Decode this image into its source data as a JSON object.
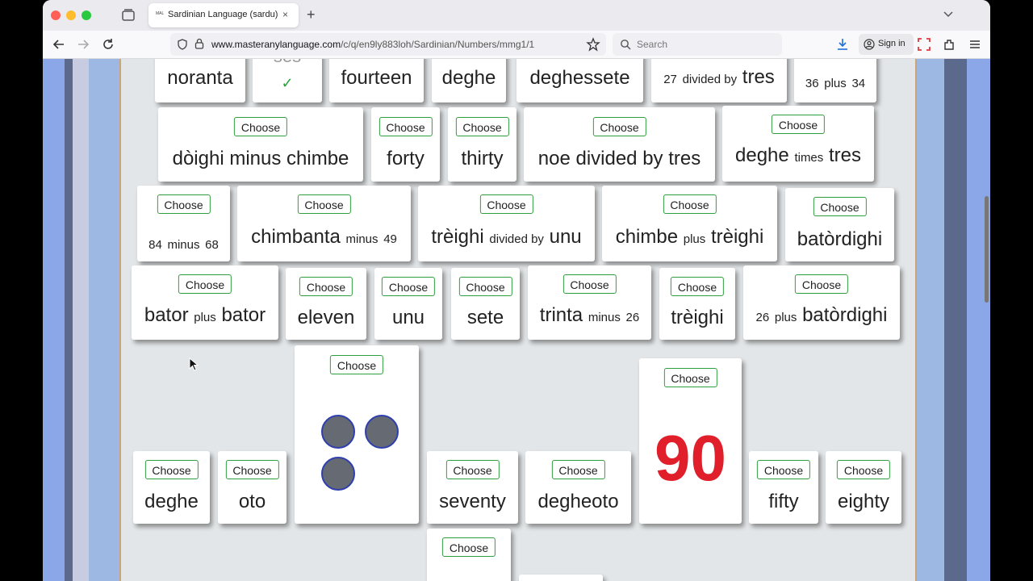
{
  "browser": {
    "tab_title": "Sardinian Language (sardu) Num",
    "tab_favicon": "MAL",
    "tab_close": "×",
    "new_tab": "+",
    "url_host": "www.masteranylanguage.com",
    "url_path": "/c/q/en9ly883loh/Sardinian/Numbers/mmg1/1",
    "search_placeholder": "Search",
    "signin_label": "Sign in"
  },
  "choose_label": "Choose",
  "rows": {
    "r0": [
      {
        "label": "noranta"
      },
      {
        "label": "ses",
        "status": "✓"
      },
      {
        "label": "fourteen"
      },
      {
        "label": "deghe"
      },
      {
        "label": "deghessete"
      },
      {
        "a": "27",
        "op": "divided by",
        "b": "tres"
      },
      {
        "a": "36",
        "op": "plus",
        "b": "34"
      }
    ],
    "r1": [
      {
        "label": "dòighi minus chimbe"
      },
      {
        "label": "forty"
      },
      {
        "label": "thirty"
      },
      {
        "label": "noe divided by tres"
      },
      {
        "a": "deghe",
        "op": "times",
        "b": "tres"
      }
    ],
    "r2": [
      {
        "a": "84",
        "op": "minus",
        "b": "68"
      },
      {
        "a": "chimbanta",
        "op": "minus",
        "b": "49"
      },
      {
        "a": "trèighi",
        "op": "divided by",
        "b": "unu"
      },
      {
        "a": "chimbe",
        "op": "plus",
        "b": "trèighi"
      },
      {
        "label": "batòrdighi"
      }
    ],
    "r3": [
      {
        "a": "bator",
        "op": "plus",
        "b": "bator"
      },
      {
        "label": "eleven"
      },
      {
        "label": "unu"
      },
      {
        "label": "sete"
      },
      {
        "a": "trinta",
        "op": "minus",
        "b": "26"
      },
      {
        "label": "trèighi"
      },
      {
        "a": "26",
        "op": "plus",
        "b": "batòrdighi"
      }
    ],
    "r4": [
      {
        "label": "deghe"
      },
      {
        "label": "oto"
      },
      {
        "dots": 3
      },
      {
        "label": "seventy"
      },
      {
        "label": "degheoto"
      },
      {
        "number": "90"
      },
      {
        "label": "fifty"
      },
      {
        "label": "eighty"
      }
    ]
  }
}
